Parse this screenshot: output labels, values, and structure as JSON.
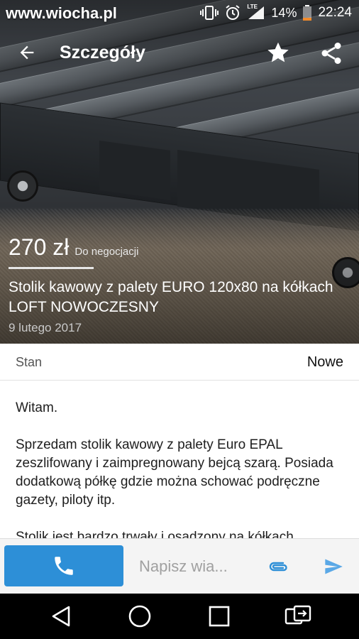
{
  "status_bar": {
    "watermark": "www.wiocha.pl",
    "network_label": "LTE",
    "battery": "14%",
    "time": "22:24"
  },
  "app_bar": {
    "title": "Szczegóły",
    "icons": [
      "back-arrow-icon",
      "star-icon",
      "share-icon"
    ]
  },
  "listing": {
    "price": "270 zł",
    "price_note": "Do negocjacji",
    "title": "Stolik kawowy z palety EURO 120x80 na kółkach LOFT NOWOCZESNY",
    "date": "9 lutego 2017"
  },
  "details": {
    "condition_label": "Stan",
    "condition_value": "Nowe"
  },
  "description": {
    "paragraphs": [
      "Witam.",
      "Sprzedam stolik kawowy z palety Euro EPAL zeszlifowany i zaimpregnowany bejcą szarą. Posiada dodatkową półkę gdzie można schować podręczne gazety, piloty itp.",
      "Stolik jest bardzo trwały i osadzony na kółkach"
    ]
  },
  "action_bar": {
    "message_placeholder": "Napisz wia...",
    "icons": [
      "phone-icon",
      "paperclip-icon",
      "send-icon"
    ]
  },
  "colors": {
    "call_button": "#2d8fd7",
    "send_icon": "#5aa8e6",
    "attach_icon": "#2d8fd7"
  },
  "nav_bar": {
    "icons": [
      "back-triangle-icon",
      "home-circle-icon",
      "recents-square-icon",
      "switch-app-icon"
    ]
  }
}
